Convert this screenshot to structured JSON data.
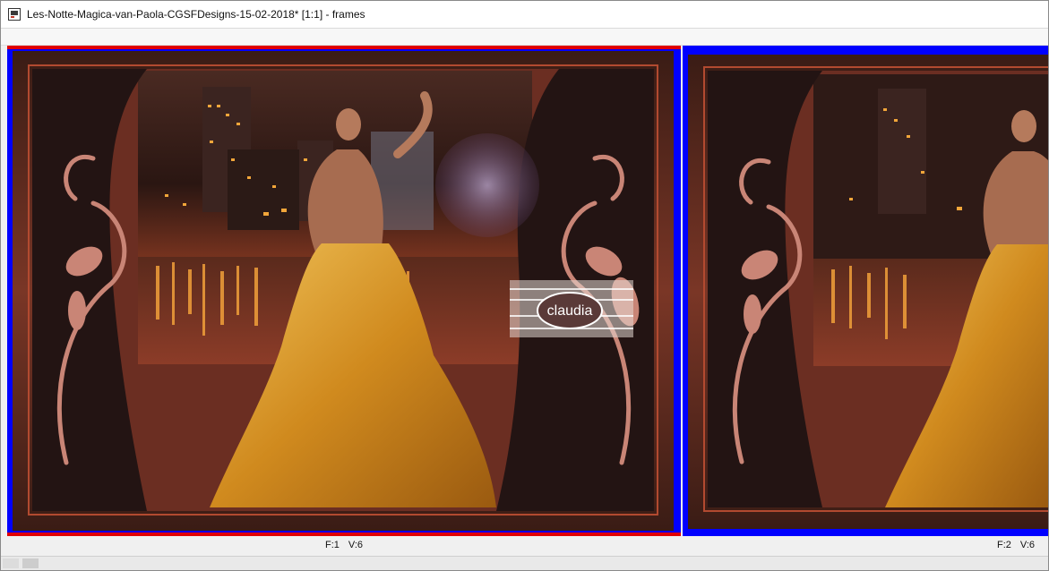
{
  "window": {
    "title": "Les-Notte-Magica-van-Paola-CGSFDesigns-15-02-2018* [1:1] - frames",
    "icon": "image-file-icon"
  },
  "frames": [
    {
      "frame_label": "F:1",
      "version_label": "V:6",
      "watermark": "claudia",
      "selected": true
    },
    {
      "frame_label": "F:2",
      "version_label": "V:6",
      "selected": false
    }
  ],
  "colors": {
    "selected_frame_border": "#e00000",
    "frame_background": "#0000ff",
    "art_brown": "#6b2e22",
    "art_dark": "#231413",
    "gown_gold": "#d99a2b"
  }
}
